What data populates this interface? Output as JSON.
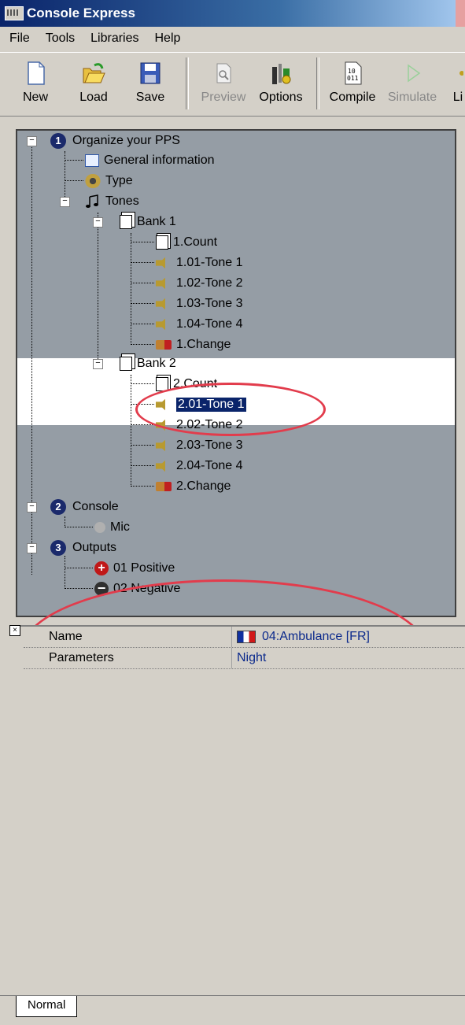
{
  "window": {
    "title": "Console Express"
  },
  "menu": [
    "File",
    "Tools",
    "Libraries",
    "Help"
  ],
  "toolbar": {
    "new": "New",
    "load": "Load",
    "save": "Save",
    "preview": "Preview",
    "options": "Options",
    "compile": "Compile",
    "simulate": "Simulate",
    "more": "Li"
  },
  "tree": {
    "organize": "Organize your PPS",
    "organize_num": "1",
    "general": "General information",
    "type": "Type",
    "tones": "Tones",
    "bank1": "Bank 1",
    "b1_count": "1.Count",
    "b1_t1": "1.01-Tone 1",
    "b1_t2": "1.02-Tone 2",
    "b1_t3": "1.03-Tone 3",
    "b1_t4": "1.04-Tone 4",
    "b1_change": "1.Change",
    "bank2": "Bank 2",
    "b2_count": "2.Count",
    "b2_t1": "2.01-Tone 1",
    "b2_t2": "2.02-Tone 2",
    "b2_t3": "2.03-Tone 3",
    "b2_t4": "2.04-Tone 4",
    "b2_change": "2.Change",
    "console": "Console",
    "console_num": "2",
    "mic": "Mic",
    "outputs": "Outputs",
    "outputs_num": "3",
    "positive": "01 Positive",
    "negative": "02 Negative"
  },
  "properties": {
    "name_key": "Name",
    "name_value": "04:Ambulance [FR]",
    "params_key": "Parameters",
    "params_value": "Night"
  },
  "tabs": {
    "normal": "Normal"
  }
}
